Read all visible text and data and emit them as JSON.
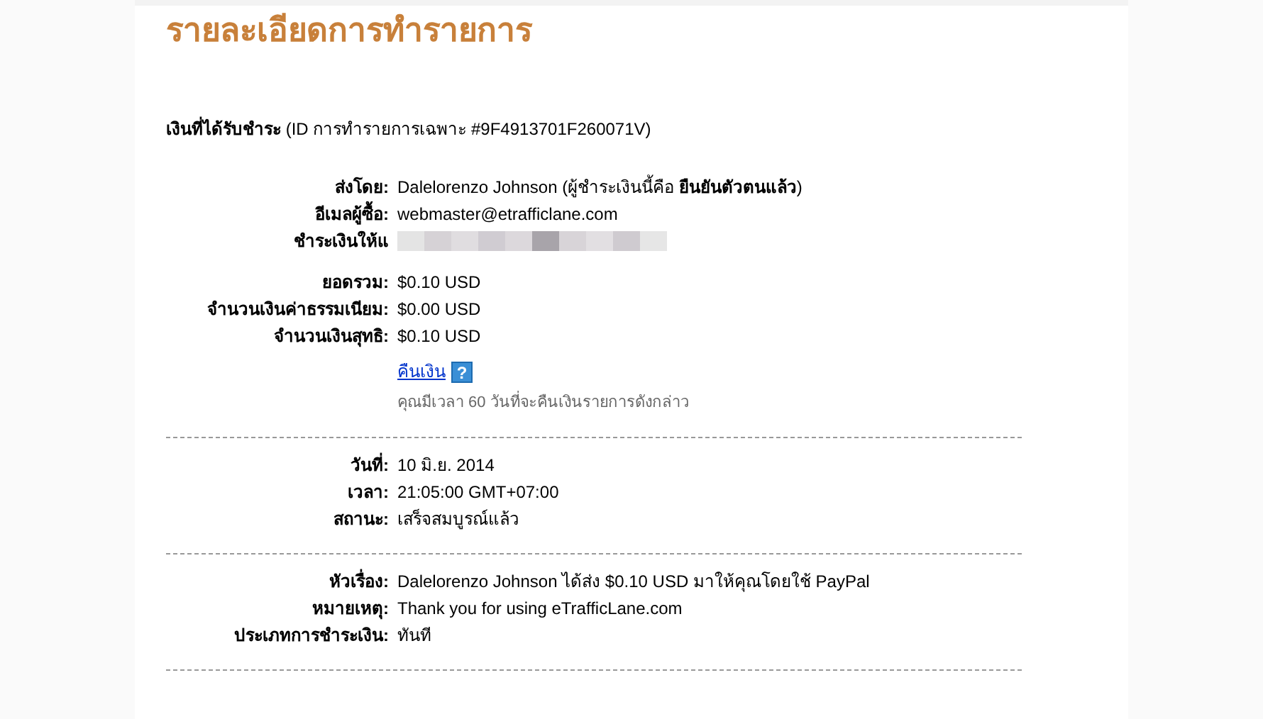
{
  "title": "รายละเอียดการทำรายการ",
  "heading": {
    "label": "เงินที่ได้รับชำระ",
    "detail": "(ID การทำรายการเฉพาะ #9F4913701F260071V)"
  },
  "sections": [
    {
      "groups": [
        [
          {
            "kind": "text",
            "label": "ส่งโดย:",
            "value": "Dalelorenzo Johnson (ผู้ชำระเงินนี้คือ **ยืนยันตัวตนแล้ว**)"
          },
          {
            "kind": "text",
            "label": "อีเมลผู้ซื้อ:",
            "value": "webmaster@etrafficlane.com"
          },
          {
            "kind": "redacted",
            "label": "ชำระเงินให้แ"
          }
        ],
        [
          {
            "kind": "text",
            "label": "ยอดรวม:",
            "value": "$0.10 USD"
          },
          {
            "kind": "text",
            "label": "จำนวนเงินค่าธรรมเนียม:",
            "value": "$0.00 USD"
          },
          {
            "kind": "text",
            "label": "จำนวนเงินสุทธิ:",
            "value": "$0.10 USD"
          },
          {
            "kind": "refund",
            "link": "คืนเงิน",
            "help": "?",
            "note": "คุณมีเวลา 60 วันที่จะคืนเงินรายการดังกล่าว"
          }
        ]
      ]
    },
    {
      "groups": [
        [
          {
            "kind": "text",
            "label": "วันที่:",
            "value": "10 มิ.ย. 2014"
          },
          {
            "kind": "text",
            "label": "เวลา:",
            "value": "21:05:00 GMT+07:00"
          },
          {
            "kind": "text",
            "label": "สถานะ:",
            "value": "เสร็จสมบูรณ์แล้ว"
          }
        ]
      ]
    },
    {
      "groups": [
        [
          {
            "kind": "text",
            "label": "หัวเรื่อง:",
            "value": "Dalelorenzo Johnson ได้ส่ง $0.10 USD มาให้คุณโดยใช้ PayPal"
          },
          {
            "kind": "text",
            "label": "หมายเหตุ:",
            "value": "Thank you for using eTrafficLane.com"
          },
          {
            "kind": "text",
            "label": "ประเภทการชำระเงิน:",
            "value": "ทันที"
          }
        ]
      ]
    }
  ]
}
